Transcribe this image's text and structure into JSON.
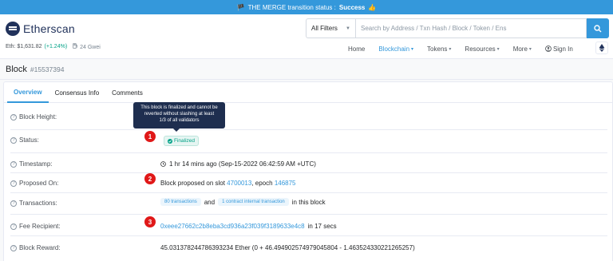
{
  "banner": {
    "flag": "🏴",
    "text": "THE MERGE transition status :",
    "status": "Success",
    "emoji": "👍"
  },
  "brand": {
    "name": "Etherscan"
  },
  "ticker": {
    "eth_price": "Eth: $1,631.82",
    "change": "(+1.24%)",
    "gas_icon": "gas-pump-icon",
    "gas": "24 Gwei"
  },
  "search": {
    "filter_label": "All Filters",
    "placeholder": "Search by Address / Txn Hash / Block / Token / Ens"
  },
  "nav": {
    "home": "Home",
    "blockchain": "Blockchain",
    "tokens": "Tokens",
    "resources": "Resources",
    "more": "More",
    "signin": "Sign In"
  },
  "page": {
    "title": "Block",
    "block_number": "#15537394"
  },
  "tabs": {
    "overview": "Overview",
    "consensus": "Consensus Info",
    "comments": "Comments"
  },
  "rows": {
    "block_height_label": "Block Height:",
    "status_label": "Status:",
    "status_value": "Finalized",
    "timestamp_label": "Timestamp:",
    "timestamp_value": "1 hr 14 mins ago (Sep-15-2022 06:42:59 AM +UTC)",
    "proposed_label": "Proposed On:",
    "proposed_prefix": "Block proposed on slot",
    "slot": "4700013",
    "epoch_prefix": ", epoch",
    "epoch": "146875",
    "transactions_label": "Transactions:",
    "tx_chip": "80 transactions",
    "tx_and": "and",
    "internal_chip": "1 contract internal transaction",
    "tx_suffix": "in this block",
    "fee_label": "Fee Recipient:",
    "fee_address": "0xeee27662c2b8eba3cd936a23f039f3189633e4c8",
    "fee_suffix": "in 17 secs",
    "reward_label": "Block Reward:",
    "reward_value": "45.031378244786393234 Ether (0 + 46.494902574979045804 - 1.463524330221265257)"
  },
  "tooltip": {
    "line1": "This block is finalized and cannot be",
    "line2": "reverted without slashing at least",
    "line3": "1/3 of all validators"
  },
  "markers": {
    "m1": "1",
    "m2": "2",
    "m3": "3"
  },
  "colors": {
    "accent": "#3498db",
    "success": "#00a186",
    "marker": "#e01818",
    "tooltip_bg": "#1e2e4f"
  }
}
